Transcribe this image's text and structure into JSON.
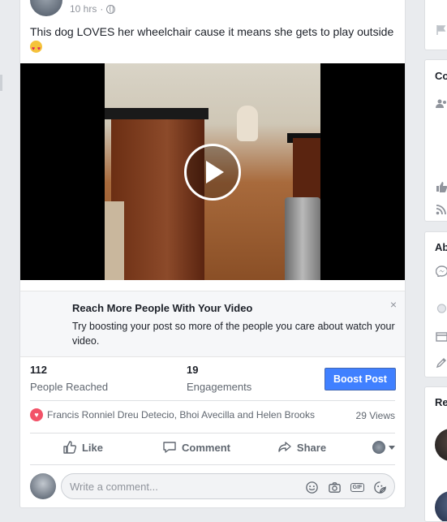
{
  "post": {
    "timestamp": "10 hrs",
    "privacy_icon": "globe-icon",
    "text": "This dog LOVES her wheelchair cause it means she gets to play outside",
    "emoji": "heart-eyes-emoji"
  },
  "video": {
    "play_icon": "play-icon"
  },
  "boost_panel": {
    "title": "Reach More People With Your Video",
    "body": "Try boosting your post so more of the people you care about watch your video.",
    "close": "×"
  },
  "stats": {
    "reached_value": "112",
    "reached_label": "People Reached",
    "engagements_value": "19",
    "engagements_label": "Engagements",
    "boost_button": "Boost Post"
  },
  "reactions": {
    "names": "Francis Ronniel Dreu Detecio, Bhoi Avecilla and Helen Brooks",
    "views": "29 Views"
  },
  "actions": {
    "like": "Like",
    "comment": "Comment",
    "share": "Share"
  },
  "composer": {
    "placeholder": "Write a comment..."
  },
  "right_column": {
    "card2_title": "Co",
    "card3_title": "Ab",
    "card4_title": "Re"
  },
  "colors": {
    "accent": "#4080ff",
    "reaction_heart": "#f25268",
    "page_bg": "#e9ebee"
  }
}
